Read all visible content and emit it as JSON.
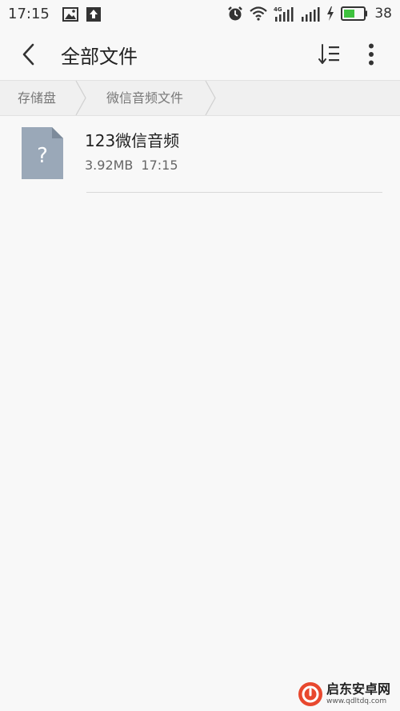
{
  "status_bar": {
    "time": "17:15",
    "battery_percent": "38",
    "network_label": "4G",
    "icons": [
      "image-icon",
      "upload-icon",
      "alarm-icon",
      "wifi-icon",
      "signal-4g-icon",
      "signal-icon",
      "charging-icon",
      "battery-icon"
    ]
  },
  "app_bar": {
    "title": "全部文件",
    "back_icon": "chevron-left-icon",
    "sort_icon": "sort-list-icon",
    "more_icon": "more-vertical-icon"
  },
  "breadcrumb": {
    "items": [
      "存储盘",
      "微信音频文件"
    ]
  },
  "files": [
    {
      "name": "123微信音频",
      "size": "3.92MB",
      "time": "17:15",
      "icon": "unknown-file-icon"
    }
  ],
  "watermark": {
    "text": "启东安卓网",
    "url": "www.qdltdq.com"
  },
  "colors": {
    "background": "#f8f8f8",
    "breadcrumb_bg": "#f0f0f0",
    "file_icon": "#9aa8b8",
    "battery_green": "#3ec23e",
    "watermark_red": "#e8482e"
  }
}
